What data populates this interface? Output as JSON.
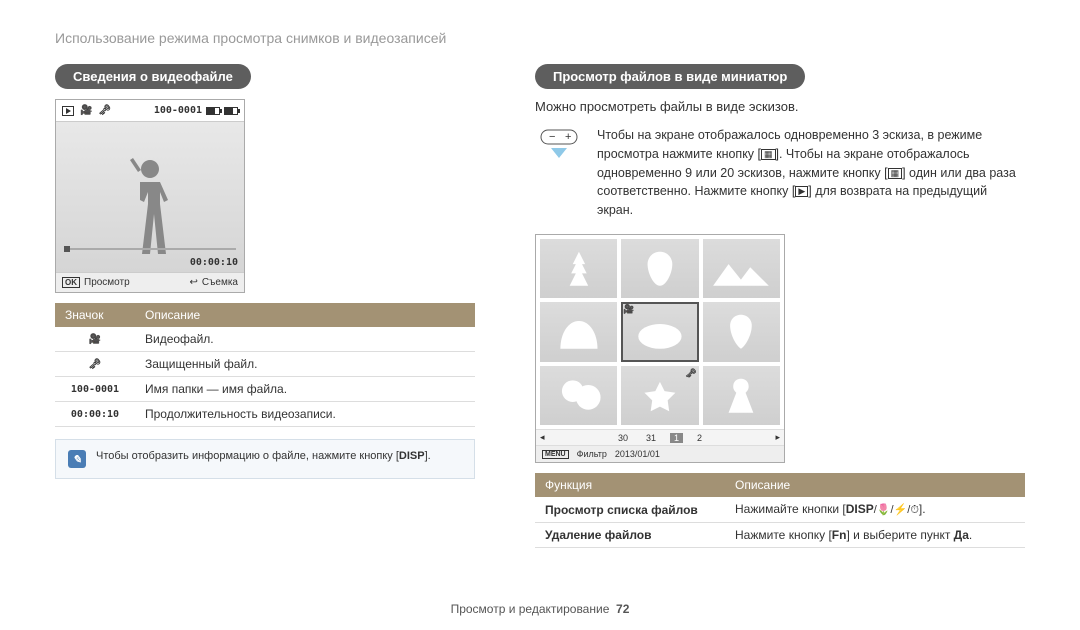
{
  "breadcrumb": "Использование режима просмотра снимков и видеозаписей",
  "left": {
    "header": "Сведения о видеофайле",
    "lcd": {
      "folder_file": "100-0001",
      "timer": "00:00:10",
      "ok_label": "OK",
      "view_label": "Просмотр",
      "shoot_label": "Съемка"
    },
    "table": {
      "col1": "Значок",
      "col2": "Описание",
      "rows": [
        {
          "icon": "🎥",
          "desc": "Видеофайл."
        },
        {
          "icon": "🗝",
          "desc": "Защищенный файл."
        },
        {
          "icon": "100-0001",
          "desc": "Имя папки — имя файла."
        },
        {
          "icon": "00:00:10",
          "desc": "Продолжительность видеозаписи."
        }
      ]
    },
    "tip_before": "Чтобы отобразить информацию о файле, нажмите кнопку [",
    "tip_disp": "DISP",
    "tip_after": "]."
  },
  "right": {
    "header": "Просмотр файлов в виде миниатюр",
    "intro": "Можно просмотреть файлы в виде эскизов.",
    "instruction_before": "Чтобы на экране отображалось одновременно 3 эскиза, в режиме просмотра нажмите кнопку [",
    "instruction_mid": "]. Чтобы на экране отображалось одновременно 9 или 20 эскизов, нажмите кнопку [",
    "instruction_mid2": "] один или два раза соответственно. Нажмите кнопку [",
    "instruction_after": "] для возврата на предыдущий экран.",
    "thumb": {
      "days": [
        "30",
        "31",
        "1",
        "2"
      ],
      "menu": "MENU",
      "filter": "Фильтр",
      "date": "2013/01/01"
    },
    "func_table": {
      "col1": "Функция",
      "col2": "Описание",
      "rows": [
        {
          "f": "Просмотр списка файлов",
          "d_before": "Нажимайте кнопки [",
          "d_disp": "DISP",
          "d_icons": "/🌷/⚡/⏱",
          "d_after": "]."
        },
        {
          "f": "Удаление файлов",
          "d_before": "Нажмите кнопку [",
          "d_fn": "Fn",
          "d_mid": "] и выберите пункт ",
          "d_bold": "Да",
          "d_after": "."
        }
      ]
    }
  },
  "footer": {
    "text": "Просмотр и редактирование",
    "page": "72"
  }
}
